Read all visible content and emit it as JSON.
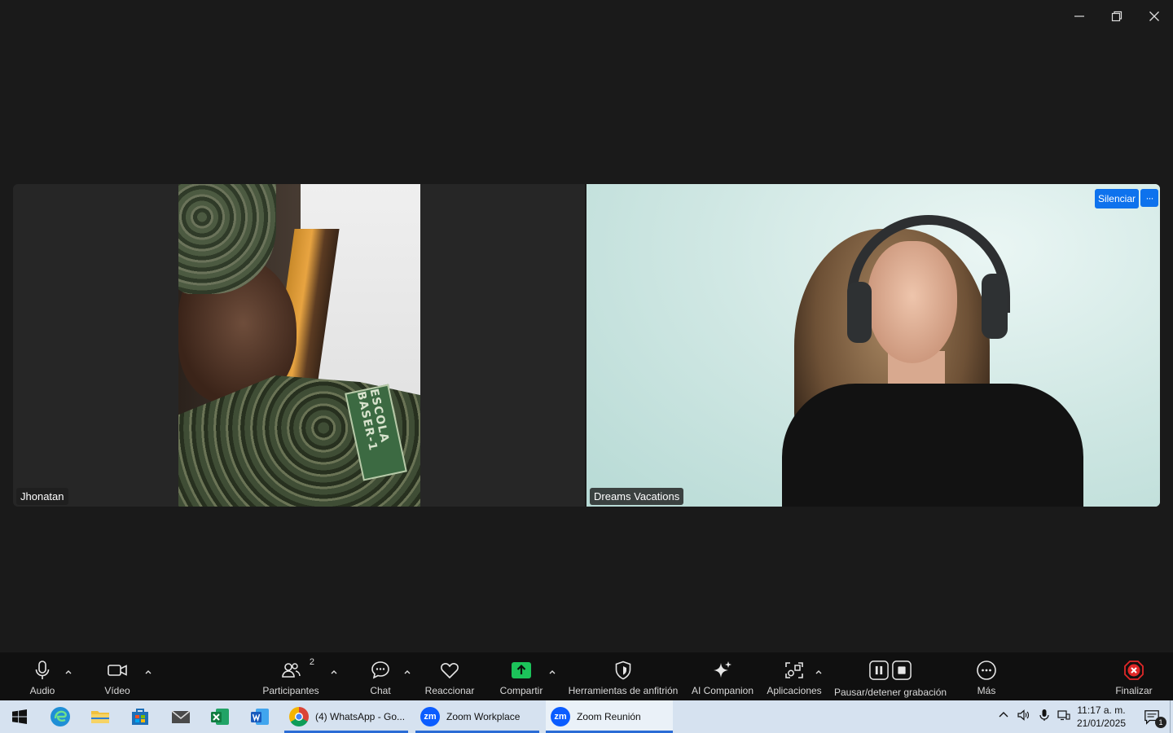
{
  "window": {
    "controls": {
      "minimize": "minimize-icon",
      "restore": "restore-icon",
      "close": "close-icon"
    }
  },
  "participants_tiles": [
    {
      "name": "Jhonatan",
      "patch_text": "ESCOLA BASER-1"
    },
    {
      "name": "Dreams Vacations",
      "silence_label": "Silenciar",
      "more_label": "···"
    }
  ],
  "toolbar": {
    "audio": "Audio",
    "video": "Vídeo",
    "participants": "Participantes",
    "participants_count": "2",
    "chat": "Chat",
    "react": "Reaccionar",
    "share": "Compartir",
    "host_tools": "Herramientas de anfitrión",
    "ai_companion": "AI Companion",
    "apps": "Aplicaciones",
    "recording": "Pausar/detener grabación",
    "more": "Más",
    "end": "Finalizar",
    "colors": {
      "share_green": "#1cc35a",
      "end_red": "#e02828",
      "accent_blue": "#0e72ed"
    }
  },
  "taskbar": {
    "pinned": [
      "windows-start-icon",
      "edge-icon",
      "file-explorer-icon",
      "store-icon",
      "mail-icon",
      "excel-icon",
      "word-icon"
    ],
    "apps": [
      {
        "label": "(4) WhatsApp - Go...",
        "icon": "chrome-icon"
      },
      {
        "label": "Zoom Workplace",
        "icon": "zoom-icon"
      },
      {
        "label": "Zoom Reunión",
        "icon": "zoom-icon"
      }
    ],
    "time": "11:17 a. m.",
    "date": "21/01/2025",
    "notification_count": "1"
  }
}
